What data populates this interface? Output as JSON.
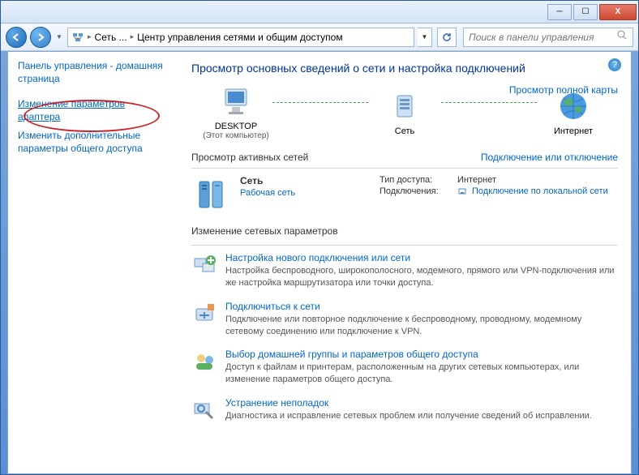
{
  "titlebar": {},
  "toolbar": {
    "breadcrumb1": "Сеть ...",
    "breadcrumb2": "Центр управления сетями и общим доступом",
    "search_placeholder": "Поиск в панели управления"
  },
  "sidebar": {
    "home": "Панель управления - домашняя страница",
    "link1": "Изменение параметров адаптера",
    "link2": "Изменить дополнительные параметры общего доступа"
  },
  "main": {
    "heading": "Просмотр основных сведений о сети и настройка подключений",
    "map_link": "Просмотр полной карты",
    "map": {
      "n1_label": "DESKTOP",
      "n1_sub": "(Этот компьютер)",
      "n2_label": "Сеть",
      "n3_label": "Интернет"
    },
    "active": {
      "title": "Просмотр активных сетей",
      "link": "Подключение или отключение",
      "net_name": "Сеть",
      "net_type": "Рабочая сеть",
      "access_lbl": "Тип доступа:",
      "access_val": "Интернет",
      "conn_lbl": "Подключения:",
      "conn_val": "Подключение по локальной сети"
    },
    "settings": {
      "title": "Изменение сетевых параметров",
      "items": [
        {
          "lnk": "Настройка нового подключения или сети",
          "desc": "Настройка беспроводного, широкополосного, модемного, прямого или VPN-подключения или же настройка маршрутизатора или точки доступа."
        },
        {
          "lnk": "Подключиться к сети",
          "desc": "Подключение или повторное подключение к беспроводному, проводному, модемному сетевому соединению или подключение к VPN."
        },
        {
          "lnk": "Выбор домашней группы и параметров общего доступа",
          "desc": "Доступ к файлам и принтерам, расположенным на других сетевых компьютерах, или изменение параметров общего доступа."
        },
        {
          "lnk": "Устранение неполадок",
          "desc": "Диагностика и исправление сетевых проблем или получение сведений об исправлении."
        }
      ]
    }
  }
}
